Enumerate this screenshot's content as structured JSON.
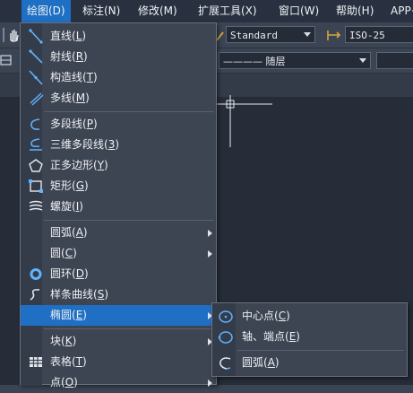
{
  "menubar": {
    "draw": "绘图(D)",
    "dimension": "标注(N)",
    "modify": "修改(M)",
    "ext_tools": "扩展工具(X)",
    "window": "窗口(W)",
    "help": "帮助(H)",
    "app": "APP+"
  },
  "toolbar": {
    "text_style": "Standard",
    "dim_style": "ISO-25",
    "linetype": "———— 随层"
  },
  "draw_menu": {
    "items": [
      {
        "text": "直线",
        "key": "L",
        "icon": "line-icon"
      },
      {
        "text": "射线",
        "key": "R",
        "icon": "ray-icon"
      },
      {
        "text": "构造线",
        "key": "T",
        "icon": "xline-icon"
      },
      {
        "text": "多线",
        "key": "M",
        "icon": "mline-icon"
      },
      {
        "text": "多段线",
        "key": "P",
        "icon": "polyline-icon"
      },
      {
        "text": "三维多段线",
        "key": "3",
        "icon": "3dpolyline-icon"
      },
      {
        "text": "正多边形",
        "key": "Y",
        "icon": "polygon-icon"
      },
      {
        "text": "矩形",
        "key": "G",
        "icon": "rectangle-icon"
      },
      {
        "text": "螺旋",
        "key": "I",
        "icon": "helix-icon"
      },
      {
        "text": "圆弧",
        "key": "A"
      },
      {
        "text": "圆",
        "key": "C"
      },
      {
        "text": "圆环",
        "key": "D",
        "icon": "donut-icon"
      },
      {
        "text": "样条曲线",
        "key": "S",
        "icon": "spline-icon"
      },
      {
        "text": "椭圆",
        "key": "E"
      },
      {
        "text": "块",
        "key": "K"
      },
      {
        "text": "表格",
        "key": "T",
        "icon": "table-icon"
      },
      {
        "text": "点",
        "key": "O"
      }
    ]
  },
  "ellipse_submenu": {
    "items": [
      {
        "text": "中心点",
        "key": "C",
        "icon": "ellipse-center-icon"
      },
      {
        "text": "轴、端点",
        "key": "E",
        "icon": "ellipse-axis-icon"
      },
      {
        "text": "圆弧",
        "key": "A",
        "icon": "ellipse-arc-icon"
      }
    ]
  },
  "colors": {
    "highlight": "#1f6fc4",
    "menu_bg": "#3d4452",
    "icon_blue": "#4aa3ff"
  }
}
